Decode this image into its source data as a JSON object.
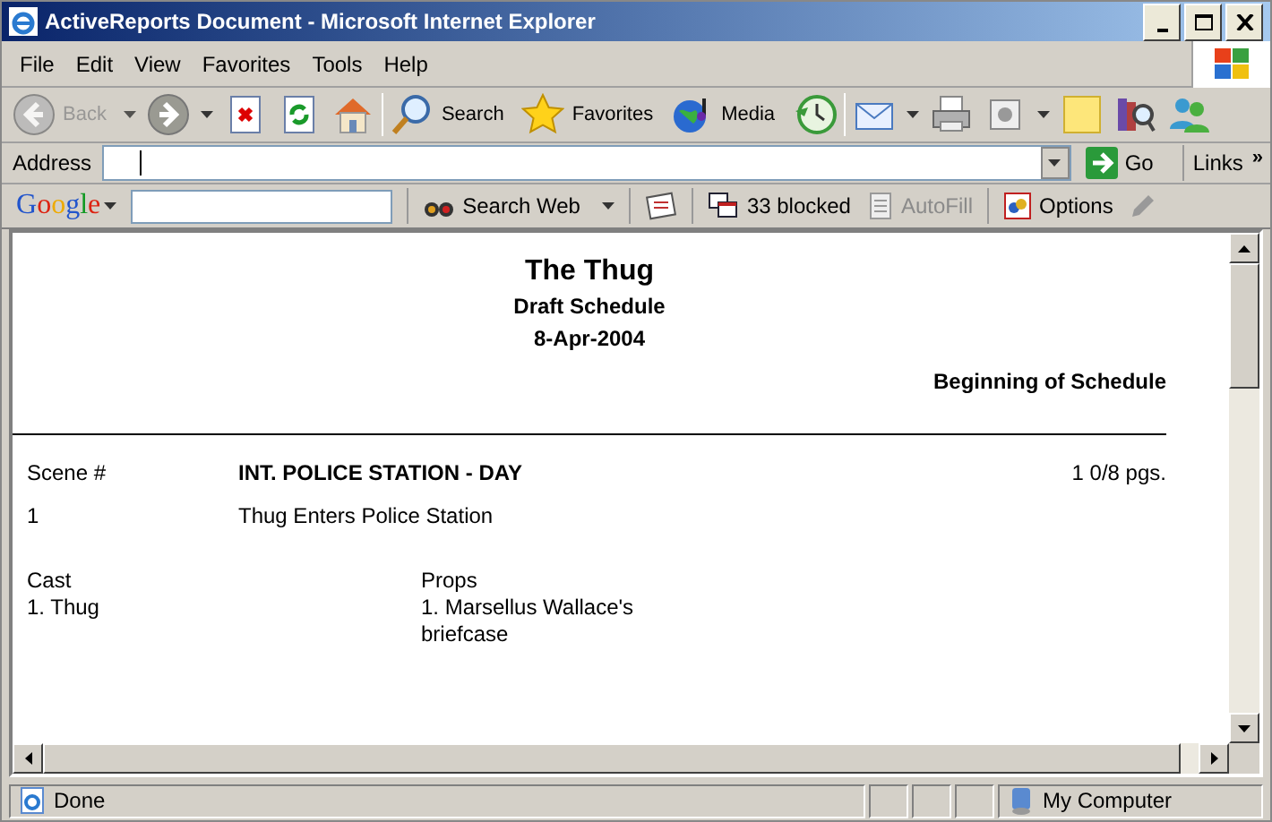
{
  "window": {
    "title": "ActiveReports Document - Microsoft Internet Explorer"
  },
  "menu": [
    "File",
    "Edit",
    "View",
    "Favorites",
    "Tools",
    "Help"
  ],
  "toolbar": [
    {
      "kind": "back",
      "label": "Back",
      "disabled": true,
      "dropdown": true
    },
    {
      "kind": "forward",
      "disabled": false,
      "dropdown": true
    },
    {
      "kind": "stop",
      "disabled": false,
      "dropdown": false
    },
    {
      "kind": "refresh",
      "disabled": false,
      "dropdown": false
    },
    {
      "kind": "home",
      "disabled": false,
      "dropdown": false
    },
    {
      "kind": "search",
      "label": "Search",
      "disabled": false,
      "dropdown": false
    },
    {
      "kind": "favorites",
      "label": "Favorites",
      "disabled": false,
      "dropdown": false
    },
    {
      "kind": "media",
      "label": "Media",
      "disabled": false,
      "dropdown": false
    },
    {
      "kind": "history",
      "disabled": false,
      "dropdown": false
    },
    {
      "kind": "mail",
      "disabled": false,
      "dropdown": true
    },
    {
      "kind": "print",
      "disabled": false,
      "dropdown": false
    },
    {
      "kind": "edit",
      "disabled": false,
      "dropdown": true
    },
    {
      "kind": "discuss",
      "disabled": false,
      "dropdown": false
    },
    {
      "kind": "research",
      "disabled": false,
      "dropdown": false
    },
    {
      "kind": "messenger",
      "disabled": false,
      "dropdown": false
    }
  ],
  "address": {
    "label": "Address",
    "go": "Go",
    "links": "Links",
    "more": "»"
  },
  "google_bar": {
    "logo": "Google",
    "search_web": "Search Web",
    "blocked": "33 blocked",
    "autofill": {
      "label": "AutoFill",
      "disabled": true
    },
    "options": "Options"
  },
  "report": {
    "title": "The Thug",
    "subtitle": "Draft Schedule",
    "date": "8-Apr-2004",
    "section": "Beginning of Schedule",
    "scene_label": "Scene #",
    "scene_heading": "INT. POLICE STATION - DAY",
    "pages": "1 0/8 pgs.",
    "scene_number": "1",
    "scene_description": "Thug Enters Police Station",
    "cast": {
      "label": "Cast",
      "items": [
        "1. Thug"
      ]
    },
    "props": {
      "label": "Props",
      "items": [
        "1. Marsellus Wallace's briefcase"
      ]
    }
  },
  "status_bar": {
    "text": "Done",
    "zone": "My Computer"
  }
}
